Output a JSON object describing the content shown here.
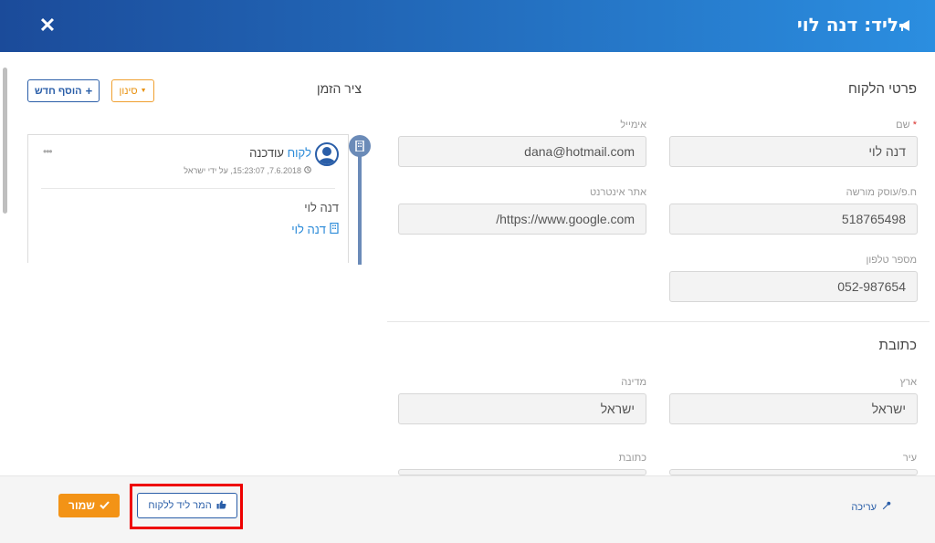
{
  "header": {
    "title": "ליד: דנה לוי",
    "title_icon": "megaphone-icon",
    "close_icon": "close-icon",
    "close_glyph": "✕"
  },
  "customer": {
    "section_title": "פרטי הלקוח",
    "fields": {
      "name": {
        "label": "שם",
        "required_mark": "*",
        "value": "דנה לוי"
      },
      "email": {
        "label": "אימייל",
        "value": "dana@hotmail.com"
      },
      "company_id": {
        "label": "ח.פ/עוסק מורשה",
        "value": "518765498"
      },
      "website": {
        "label": "אתר אינטרנט",
        "value": "https://www.google.com/"
      },
      "phone": {
        "label": "מספר טלפון",
        "value": "052-987654"
      }
    }
  },
  "address": {
    "section_title": "כתובת",
    "fields": {
      "country": {
        "label": "ארץ",
        "value": "ישראל"
      },
      "state": {
        "label": "מדינה",
        "value": "ישראל"
      },
      "city": {
        "label": "עיר",
        "value": ""
      },
      "street": {
        "label": "כתובת",
        "value": ""
      }
    }
  },
  "timeline": {
    "title": "ציר הזמן",
    "add_button": "הוסף חדש",
    "filter_button": "סינון",
    "card": {
      "link_word": "לקוח",
      "action_word": "עודכנה",
      "meta": "7.6.2018, 15:23:07, על ידי ישראל",
      "name": "דנה לוי",
      "link_label": "דנה לוי",
      "dots": "•••"
    }
  },
  "footer": {
    "save_label": "שמור",
    "convert_label": "המר ליד ללקוח",
    "edit_label": "עריכה"
  },
  "colors": {
    "brand_dark": "#1b4b9a",
    "brand_light": "#2b8ee0",
    "accent": "#f39316",
    "highlight": "#e00000"
  }
}
